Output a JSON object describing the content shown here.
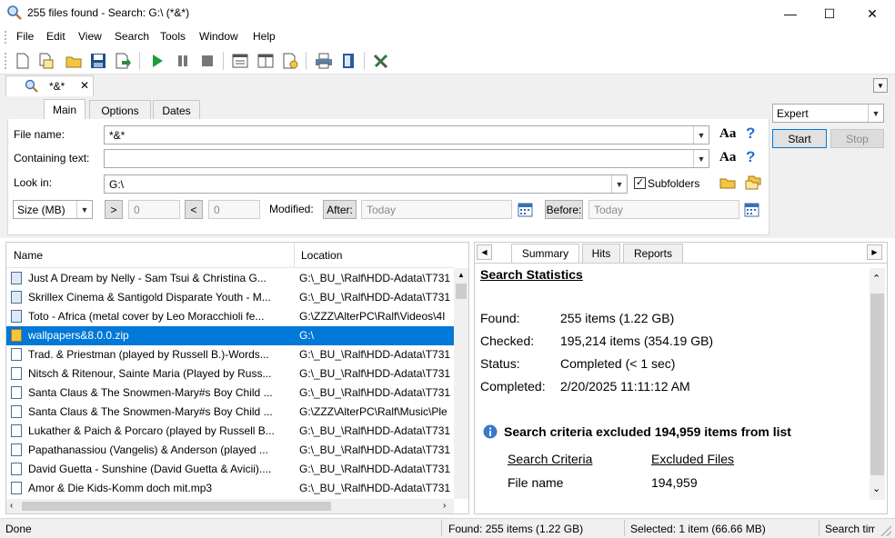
{
  "window": {
    "title": "255 files found - Search: G:\\ (*&*)",
    "minimize": "—",
    "maximize": "☐",
    "close": "✕"
  },
  "menu": [
    "File",
    "Edit",
    "View",
    "Search",
    "Tools",
    "Window",
    "Help"
  ],
  "doc_tab": {
    "label": "*&*",
    "close": "✕"
  },
  "mode_select": {
    "value": "Expert"
  },
  "buttons": {
    "start": "Start",
    "stop": "Stop"
  },
  "form_tabs": [
    "Main",
    "Options",
    "Dates"
  ],
  "form": {
    "file_name_label": "File name:",
    "file_name_value": "*&*",
    "containing_label": "Containing text:",
    "containing_value": "",
    "look_in_label": "Look in:",
    "look_in_value": "G:\\",
    "subfolders_label": "Subfolders",
    "subfolders_checked": true,
    "case_label": "Aa",
    "help_label": "?",
    "size_unit": "Size (MB)",
    "gt_label": ">",
    "lt_label": "<",
    "size_min": "0",
    "size_max": "0",
    "modified_label": "Modified:",
    "after_label": "After:",
    "after_value": "Today",
    "before_label": "Before:",
    "before_value": "Today"
  },
  "results": {
    "columns": {
      "name": "Name",
      "location": "Location"
    },
    "rows": [
      {
        "name": "Just A Dream  by Nelly - Sam Tsui & Christina G...",
        "location": "G:\\_BU_\\Ralf\\HDD-Adata\\T731"
      },
      {
        "name": "Skrillex Cinema & Santigold Disparate Youth - M...",
        "location": "G:\\_BU_\\Ralf\\HDD-Adata\\T731"
      },
      {
        "name": "Toto - Africa (metal cover by Leo Moracchioli fe...",
        "location": "G:\\ZZZ\\AlterPC\\Ralf\\Videos\\4I"
      },
      {
        "name": "wallpapers&8.0.0.zip",
        "location": "G:\\"
      },
      {
        "name": "Trad. & Priestman (played by Russell B.)-Words...",
        "location": "G:\\_BU_\\Ralf\\HDD-Adata\\T731"
      },
      {
        "name": "Nitsch & Ritenour, Sainte Maria (Played by Russ...",
        "location": "G:\\_BU_\\Ralf\\HDD-Adata\\T731"
      },
      {
        "name": "Santa Claus & The Snowmen-Mary#s Boy Child ...",
        "location": "G:\\_BU_\\Ralf\\HDD-Adata\\T731"
      },
      {
        "name": "Santa Claus & The Snowmen-Mary#s Boy Child ...",
        "location": "G:\\ZZZ\\AlterPC\\Ralf\\Music\\Ple"
      },
      {
        "name": "Lukather & Paich & Porcaro (played by Russell B...",
        "location": "G:\\_BU_\\Ralf\\HDD-Adata\\T731"
      },
      {
        "name": "Papathanassiou (Vangelis) & Anderson (played ...",
        "location": "G:\\_BU_\\Ralf\\HDD-Adata\\T731"
      },
      {
        "name": "David Guetta - Sunshine (David Guetta & Avicii)....",
        "location": "G:\\_BU_\\Ralf\\HDD-Adata\\T731"
      },
      {
        "name": "Amor & Die Kids-Komm doch mit.mp3",
        "location": "G:\\_BU_\\Ralf\\HDD-Adata\\T731"
      }
    ],
    "selected_index": 3
  },
  "right_tabs": [
    "Summary",
    "Hits",
    "Reports"
  ],
  "summary": {
    "heading": "Search Statistics",
    "stats": [
      {
        "label": "Found:",
        "value": "255 items (1.22 GB)"
      },
      {
        "label": "Checked:",
        "value": "195,214 items (354.19 GB)"
      },
      {
        "label": "Status:",
        "value": "Completed (< 1 sec)"
      },
      {
        "label": "Completed:",
        "value": "2/20/2025 11:11:12 AM"
      }
    ],
    "info": "Search criteria excluded 194,959 items from list",
    "criteria_header": "Search Criteria",
    "excluded_header": "Excluded Files",
    "criteria_row": {
      "name": "File name",
      "count": "194,959"
    }
  },
  "status": {
    "left": "Done",
    "found": "Found: 255 items (1.22 GB)",
    "selected": "Selected: 1 item (66.66 MB)",
    "time": "Search tim"
  }
}
